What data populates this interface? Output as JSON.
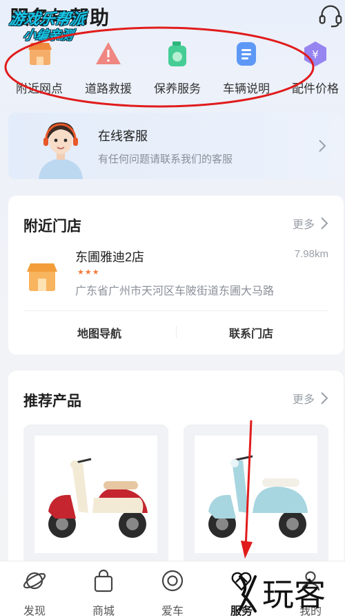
{
  "header": {
    "title": "服务与帮助",
    "watermark_line1": "游戏乐帮派",
    "watermark_line2": "小编亲测",
    "headset_icon": "headset-icon"
  },
  "services": [
    {
      "label": "附近网点",
      "icon": "shop-icon",
      "color": "#f6a55a"
    },
    {
      "label": "道路救援",
      "icon": "warning-triangle-icon",
      "color": "#f0736b"
    },
    {
      "label": "保养服务",
      "icon": "maintenance-bottle-icon",
      "color": "#33c98a"
    },
    {
      "label": "车辆说明",
      "icon": "manual-document-icon",
      "color": "#4f8ef5"
    },
    {
      "label": "配件价格",
      "icon": "yuan-price-icon",
      "color": "#8d78f0"
    }
  ],
  "customer_service": {
    "title": "在线客服",
    "subtitle": "有任何问题请联系我们的客服"
  },
  "nearby_stores": {
    "title": "附近门店",
    "more": "更多",
    "store": {
      "name": "东圃雅迪2店",
      "stars": "★★★",
      "distance": "7.98km",
      "address": "广东省广州市天河区车陂街道东圃大马路"
    },
    "actions": {
      "navigate": "地图导航",
      "contact": "联系门店"
    }
  },
  "products": {
    "title": "推荐产品",
    "more": "更多"
  },
  "tabbar": [
    {
      "label": "发现",
      "icon": "planet-icon"
    },
    {
      "label": "商城",
      "icon": "shopping-bag-icon"
    },
    {
      "label": "爱车",
      "icon": "target-circle-icon"
    },
    {
      "label": "服务",
      "icon": "service-heart-icon",
      "active": true
    },
    {
      "label": "我的",
      "icon": "user-icon"
    }
  ],
  "watermark_logo": "玩客",
  "colors": {
    "annotation": "#e11b1b",
    "accent_orange": "#f27a3b",
    "watermark_cyan": "#19c7e8"
  }
}
